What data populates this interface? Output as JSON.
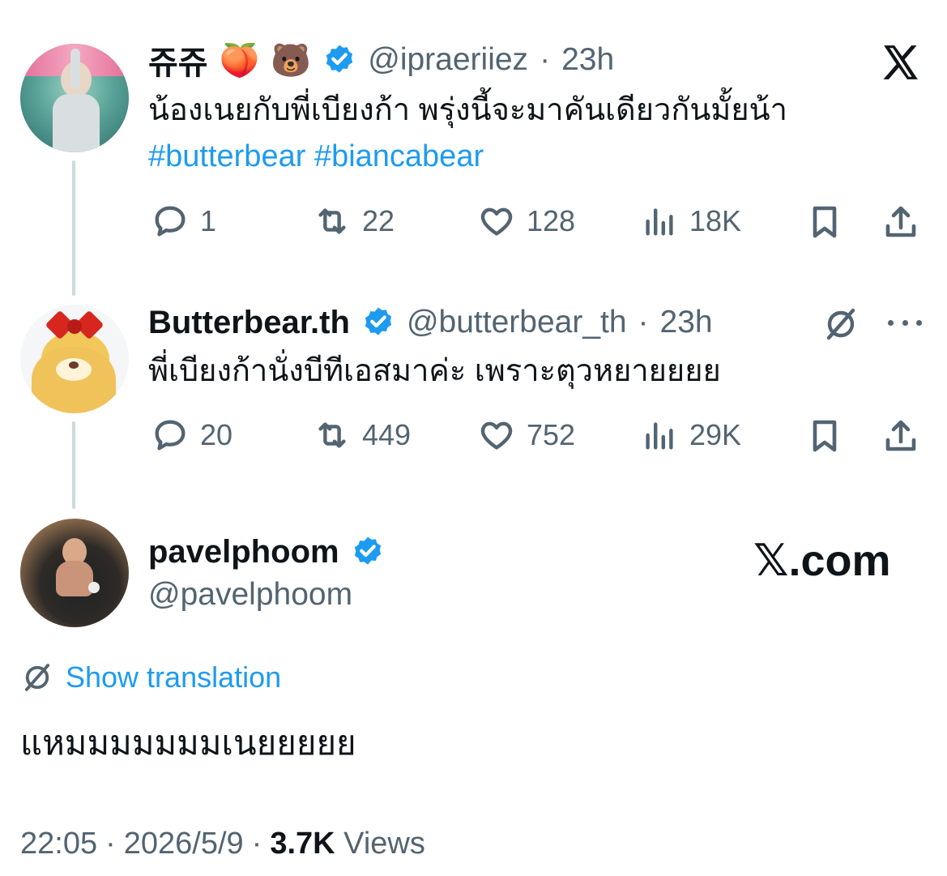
{
  "tweets": [
    {
      "display_name": "쥬쥬",
      "emojis": [
        "🍑",
        "🐻"
      ],
      "handle": "@ipraeriiez",
      "time": "23h",
      "text": "น้องเนยกับพี่เบียงก้า พรุ่งนี้จะมาคันเดียวกันมั้ยน้า",
      "hashtags": [
        "#butterbear",
        "#biancabear"
      ],
      "stats": {
        "replies": "1",
        "reposts": "22",
        "likes": "128",
        "views": "18K"
      }
    },
    {
      "display_name": "Butterbear.th",
      "handle": "@butterbear_th",
      "time": "23h",
      "text": "พี่เบียงก้านั่งบีทีเอสมาค่ะ เพราะตุวหยายยยย",
      "stats": {
        "replies": "20",
        "reposts": "449",
        "likes": "752",
        "views": "29K"
      }
    }
  ],
  "main_tweet": {
    "display_name": "pavelphoom",
    "handle": "@pavelphoom",
    "show_translation": "Show translation",
    "text": "แหมมมมมมมเนยยยยย",
    "time": "22:05",
    "date": "2026/5/9",
    "views_count": "3.7K",
    "views_label": "Views"
  },
  "watermark": "𝕏.com",
  "separator": "·",
  "icons": {
    "x_logo": "x-logo-icon",
    "verified": "verified-badge-icon",
    "reply": "reply-icon",
    "repost": "repost-icon",
    "like": "like-icon",
    "views": "views-icon",
    "bookmark": "bookmark-icon",
    "share": "share-icon",
    "translate": "translate-icon",
    "more": "more-icon"
  },
  "colors": {
    "accent": "#1d9bf0",
    "muted": "#536471",
    "text": "#0f1419"
  }
}
